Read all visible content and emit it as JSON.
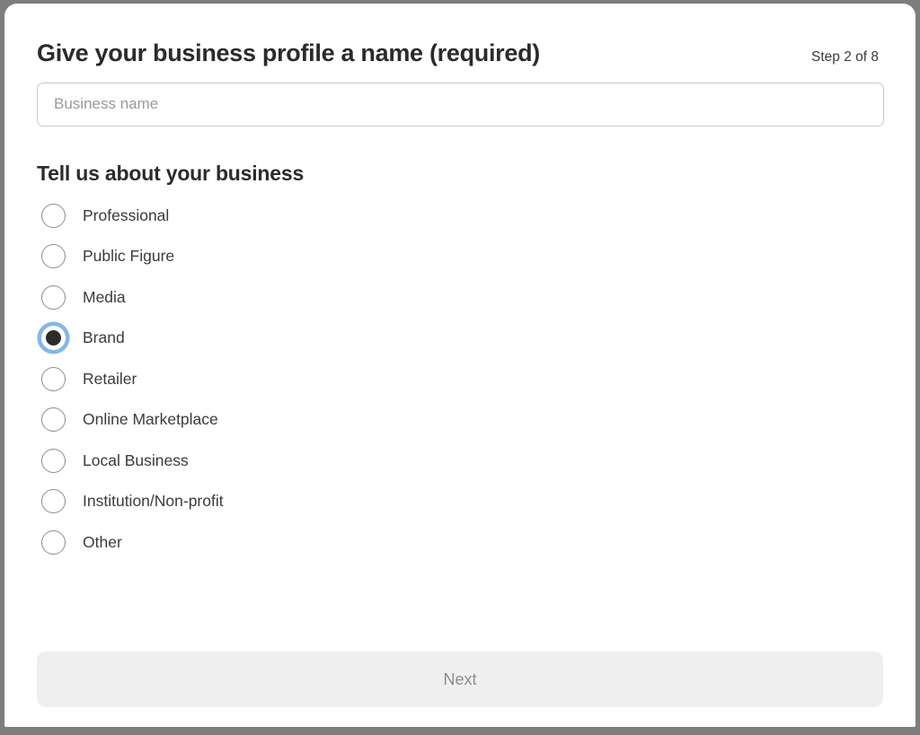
{
  "header": {
    "title": "Give your business profile a name (required)",
    "step_indicator": "Step 2 of 8"
  },
  "business_name_field": {
    "placeholder": "Business name",
    "value": ""
  },
  "business_type": {
    "section_title": "Tell us about your business",
    "selected": "Brand",
    "options": [
      {
        "label": "Professional",
        "selected": false
      },
      {
        "label": "Public Figure",
        "selected": false
      },
      {
        "label": "Media",
        "selected": false
      },
      {
        "label": "Brand",
        "selected": true
      },
      {
        "label": "Retailer",
        "selected": false
      },
      {
        "label": "Online Marketplace",
        "selected": false
      },
      {
        "label": "Local Business",
        "selected": false
      },
      {
        "label": "Institution/Non-profit",
        "selected": false
      },
      {
        "label": "Other",
        "selected": false
      }
    ]
  },
  "footer": {
    "next_label": "Next",
    "next_disabled": true
  },
  "colors": {
    "frame": "#7d7d7d",
    "card": "#ffffff",
    "text_primary": "#2b2b2b",
    "text_secondary": "#3b3b3b",
    "placeholder": "#9a9a9a",
    "radio_border": "#8d8d8d",
    "focus_ring": "#86b6e8",
    "radio_dot": "#2b2b2b",
    "button_bg": "#efefef",
    "button_text": "#8d8d8d",
    "input_border": "#c9c9c9"
  }
}
